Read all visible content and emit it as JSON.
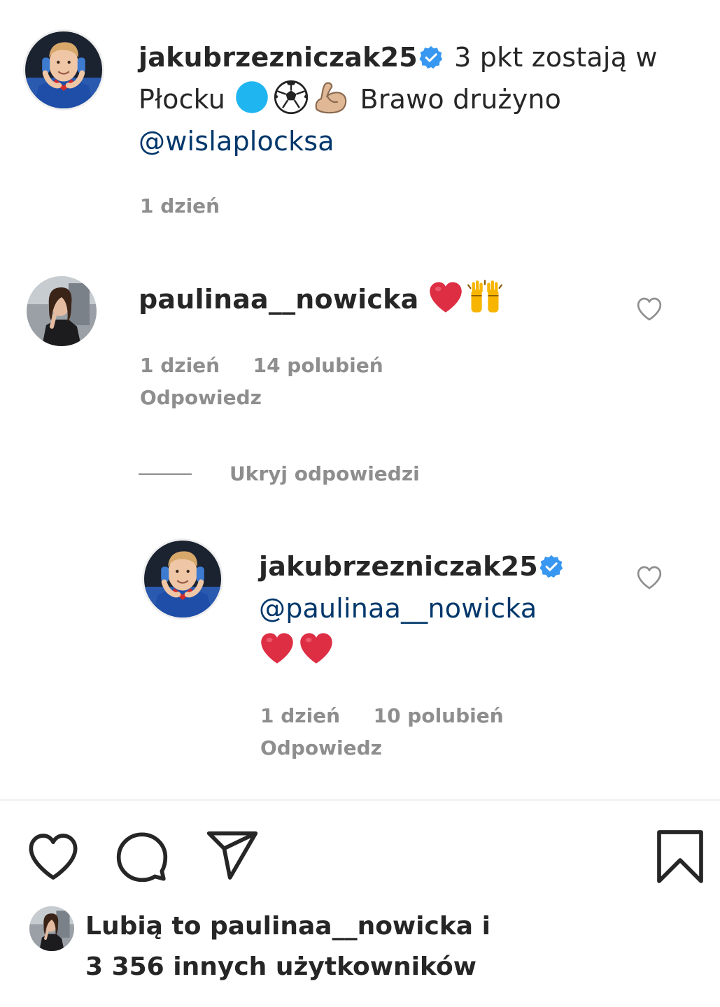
{
  "caption": {
    "username": "jakubrzezniczak25",
    "text_before": "3 pkt zostają w Płocku",
    "text_after": "Brawo drużyno",
    "mention": "@wislaplocksa",
    "time": "1 dzień",
    "verified": true,
    "emoji": [
      "blue-circle",
      "soccer-ball",
      "flexed-biceps"
    ]
  },
  "comment1": {
    "username": "paulinaa__nowicka",
    "emoji": [
      "red-heart",
      "raising-hands"
    ],
    "time": "1 dzień",
    "likes": "14 polubień",
    "reply_label": "Odpowiedz"
  },
  "toggle_replies": "Ukryj odpowiedzi",
  "reply1": {
    "username": "jakubrzezniczak25",
    "verified": true,
    "mention": "@paulinaa__nowicka",
    "emoji": [
      "red-heart",
      "red-heart"
    ],
    "time": "1 dzień",
    "likes": "10 polubień",
    "reply_label": "Odpowiedz"
  },
  "actions": {
    "like_icon": "heart-icon",
    "comment_icon": "comment-icon",
    "share_icon": "share-icon",
    "save_icon": "bookmark-icon"
  },
  "likes_summary": {
    "line1": "Lubią to paulinaa__nowicka i",
    "line2": "3 356 innych użytkowników"
  },
  "colors": {
    "text": "#262626",
    "muted": "#8e8e8e",
    "mention": "#00376b",
    "verified": "#3897f0",
    "heart_red": "#ed4956",
    "divider": "#efefef"
  }
}
